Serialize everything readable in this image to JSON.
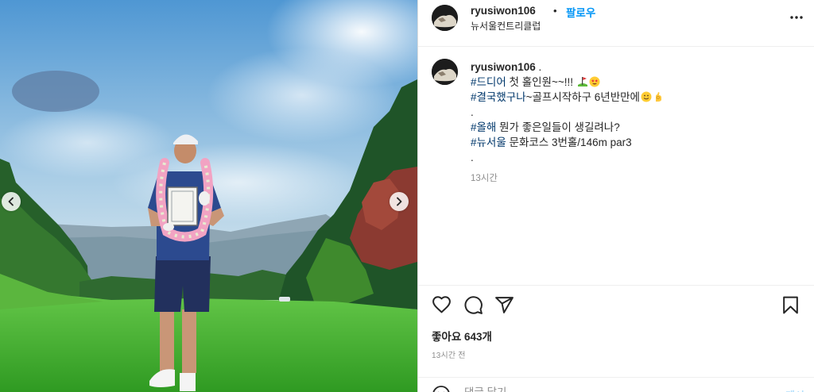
{
  "post_header": {
    "username": "ryusiwon106",
    "separator": "•",
    "follow_label": "팔로우",
    "location": "뉴서울컨트리클럽"
  },
  "caption": {
    "username": "ryusiwon106",
    "after_username": " .",
    "line1_tag": "#드디어",
    "line1_text": " 첫 홀인원~~!!! ",
    "line2_tag": "#결국했구나",
    "line2_text": "~골프시작하구 6년반만에",
    "line3_text": ".",
    "line4_tag": "#올해",
    "line4_text": " 뭔가 좋은일들이 생길려나?",
    "line5_tag": "#뉴서울",
    "line5_text": " 문화코스 3번홀/146m par3",
    "line6_text": ".",
    "time": "13시간"
  },
  "actions": {
    "icons": [
      "heart-icon",
      "comment-icon",
      "share-icon",
      "bookmark-icon"
    ]
  },
  "likes": "좋아요 643개",
  "posted_time": "13시간 전",
  "comment": {
    "placeholder": "댓글 달기...",
    "post_label": "게시"
  },
  "colors": {
    "accent": "#0095f6",
    "hashtag": "#00376b",
    "muted": "#8e8e8e",
    "post_disabled": "#b2dffc"
  }
}
